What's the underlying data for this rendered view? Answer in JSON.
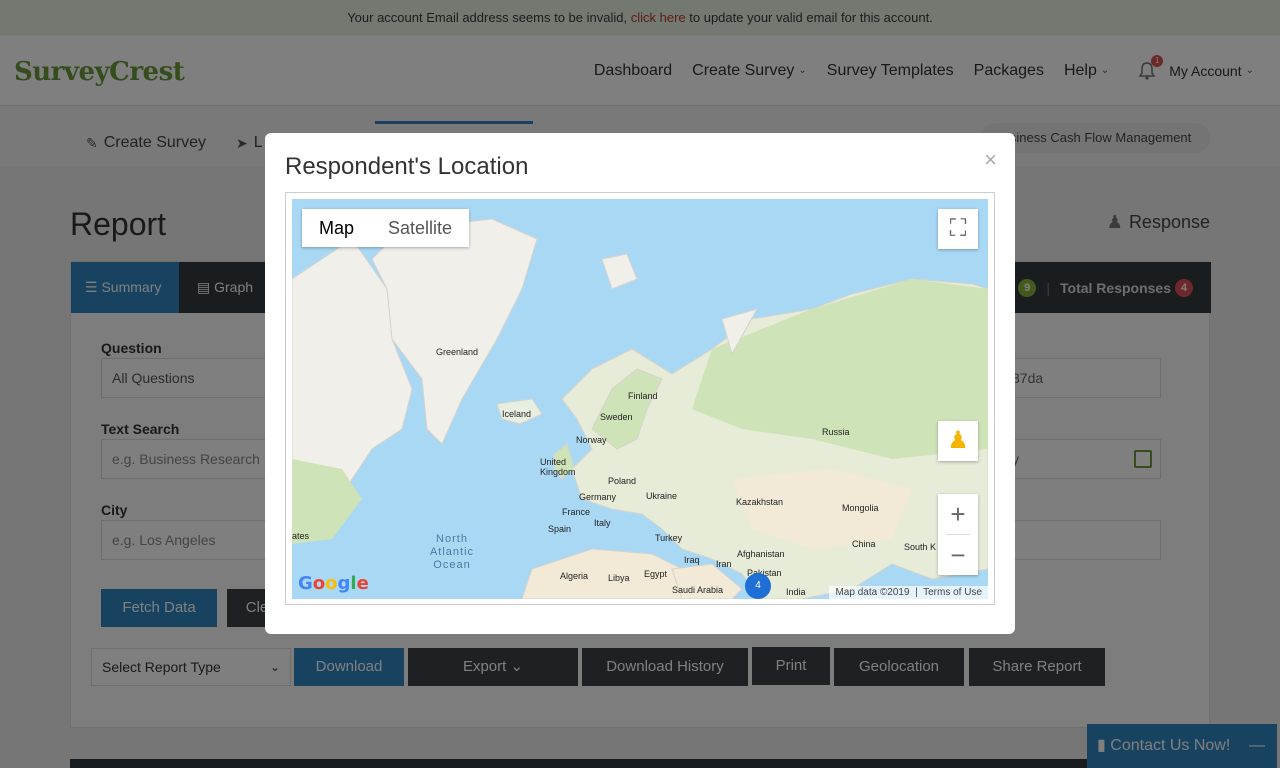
{
  "notice": {
    "before": "Your account Email address seems to be invalid,",
    "link": "click here",
    "after": "to update your valid email for this account."
  },
  "brand": "SurveyCrest",
  "nav": {
    "dashboard": "Dashboard",
    "create_survey": "Create Survey",
    "survey_templates": "Survey Templates",
    "packages": "Packages",
    "help": "Help",
    "notifications_count": "1",
    "my_account": "My Account"
  },
  "subnav": {
    "create_survey": "Create Survey",
    "launch": "L",
    "survey_name": "Business Cash Flow Management"
  },
  "page": {
    "title": "Report",
    "response_link": "Response"
  },
  "panel": {
    "tabs": {
      "summary": "Summary",
      "graph": "Graph"
    },
    "visits_label": "ts",
    "visits_count": "9",
    "total_label": "Total Responses",
    "total_count": "4",
    "question_label": "Question",
    "question_value": "All Questions",
    "text_search_label": "Text Search",
    "text_search_placeholder": "e.g. Business Research",
    "city_label": "City",
    "city_placeholder": "e.g. Los Angeles",
    "right_field1": "37da",
    "right_field2": "y",
    "right_label3": "s",
    "fetch": "Fetch Data",
    "clear": "Cle"
  },
  "actions": {
    "select_report_type": "Select Report Type",
    "download": "Download",
    "export": "Export",
    "download_history": "Download History",
    "print": "Print",
    "geolocation": "Geolocation",
    "share_report": "Share Report"
  },
  "contact": "Contact Us Now!",
  "modal": {
    "title": "Respondent's Location",
    "close": "×",
    "map_type": {
      "map": "Map",
      "satellite": "Satellite"
    },
    "cluster_count": "4",
    "attribution": {
      "data": "Map data ©2019",
      "terms": "Terms of Use"
    },
    "labels": {
      "greenland": "Greenland",
      "iceland": "Iceland",
      "finland": "Finland",
      "sweden": "Sweden",
      "norway": "Norway",
      "russia": "Russia",
      "uk": "United Kingdom",
      "poland": "Poland",
      "germany": "Germany",
      "ukraine": "Ukraine",
      "kazakhstan": "Kazakhstan",
      "france": "France",
      "spain": "Spain",
      "italy": "Italy",
      "mongolia": "Mongolia",
      "turkey": "Turkey",
      "china": "China",
      "south_k": "South K",
      "afghanistan": "Afghanistan",
      "iraq": "Iraq",
      "iran": "Iran",
      "pakistan": "Pakistan",
      "algeria": "Algeria",
      "libya": "Libya",
      "egypt": "Egypt",
      "saudi_arabia": "Saudi Arabia",
      "india": "India",
      "states": "ates",
      "ocean": "North Atlantic Ocean"
    }
  }
}
